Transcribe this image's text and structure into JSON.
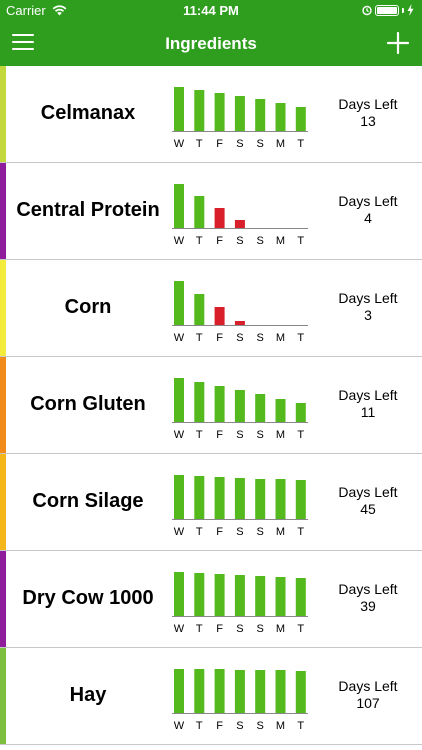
{
  "status_bar": {
    "carrier": "Carrier",
    "time": "11:44 PM"
  },
  "nav": {
    "title": "Ingredients",
    "menu_icon": "hamburger-menu-icon",
    "add_icon": "plus-icon"
  },
  "colors": {
    "nav": "#2f9e1f",
    "bar_ok": "#53b91c",
    "bar_low": "#d9202a"
  },
  "day_labels": [
    "W",
    "T",
    "F",
    "S",
    "S",
    "M",
    "T"
  ],
  "days_left_label": "Days Left",
  "items": [
    {
      "name": "Celmanax",
      "stripe": "#c3d93b",
      "days_left": "13",
      "levels": [
        1.0,
        0.93,
        0.86,
        0.8,
        0.72,
        0.64,
        0.55
      ],
      "low_from": 7
    },
    {
      "name": "Central Protein",
      "stripe": "#8e1e9c",
      "days_left": "4",
      "levels": [
        1.0,
        0.72,
        0.45,
        0.18,
        0,
        0,
        0
      ],
      "low_from": 2
    },
    {
      "name": "Corn",
      "stripe": "#f4ec3d",
      "days_left": "3",
      "levels": [
        1.0,
        0.7,
        0.4,
        0.09,
        0,
        0,
        0
      ],
      "low_from": 2
    },
    {
      "name": "Corn Gluten",
      "stripe": "#f38b1a",
      "days_left": "11",
      "levels": [
        1.0,
        0.9,
        0.82,
        0.72,
        0.63,
        0.53,
        0.44
      ],
      "low_from": 7
    },
    {
      "name": "Corn Silage",
      "stripe": "#f5b61a",
      "days_left": "45",
      "levels": [
        1.0,
        0.98,
        0.96,
        0.94,
        0.92,
        0.9,
        0.88
      ],
      "low_from": 7
    },
    {
      "name": "Dry Cow 1000",
      "stripe": "#8e1e9c",
      "days_left": "39",
      "levels": [
        1.0,
        0.98,
        0.95,
        0.93,
        0.91,
        0.89,
        0.87
      ],
      "low_from": 7
    },
    {
      "name": "Hay",
      "stripe": "#7dbf3f",
      "days_left": "107",
      "levels": [
        1.0,
        1.0,
        0.99,
        0.98,
        0.98,
        0.97,
        0.96
      ],
      "low_from": 7
    }
  ]
}
